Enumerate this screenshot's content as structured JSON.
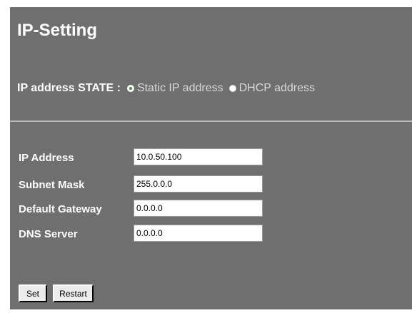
{
  "page": {
    "title": "IP-Setting"
  },
  "state": {
    "label": "IP address STATE :",
    "options": [
      {
        "label": "Static IP address",
        "selected": true
      },
      {
        "label": "DHCP address",
        "selected": false
      }
    ]
  },
  "fields": [
    {
      "label": "IP Address",
      "value": "10.0.50.100"
    },
    {
      "label": "Subnet Mask",
      "value": "255.0.0.0"
    },
    {
      "label": "Default Gateway",
      "value": "0.0.0.0"
    },
    {
      "label": "DNS Server",
      "value": "0.0.0.0"
    }
  ],
  "buttons": {
    "set_label": "Set",
    "restart_label": "Restart"
  },
  "colors": {
    "panel_background": "#6f6f70",
    "selected_radio_accent": "#3f9a3f"
  }
}
